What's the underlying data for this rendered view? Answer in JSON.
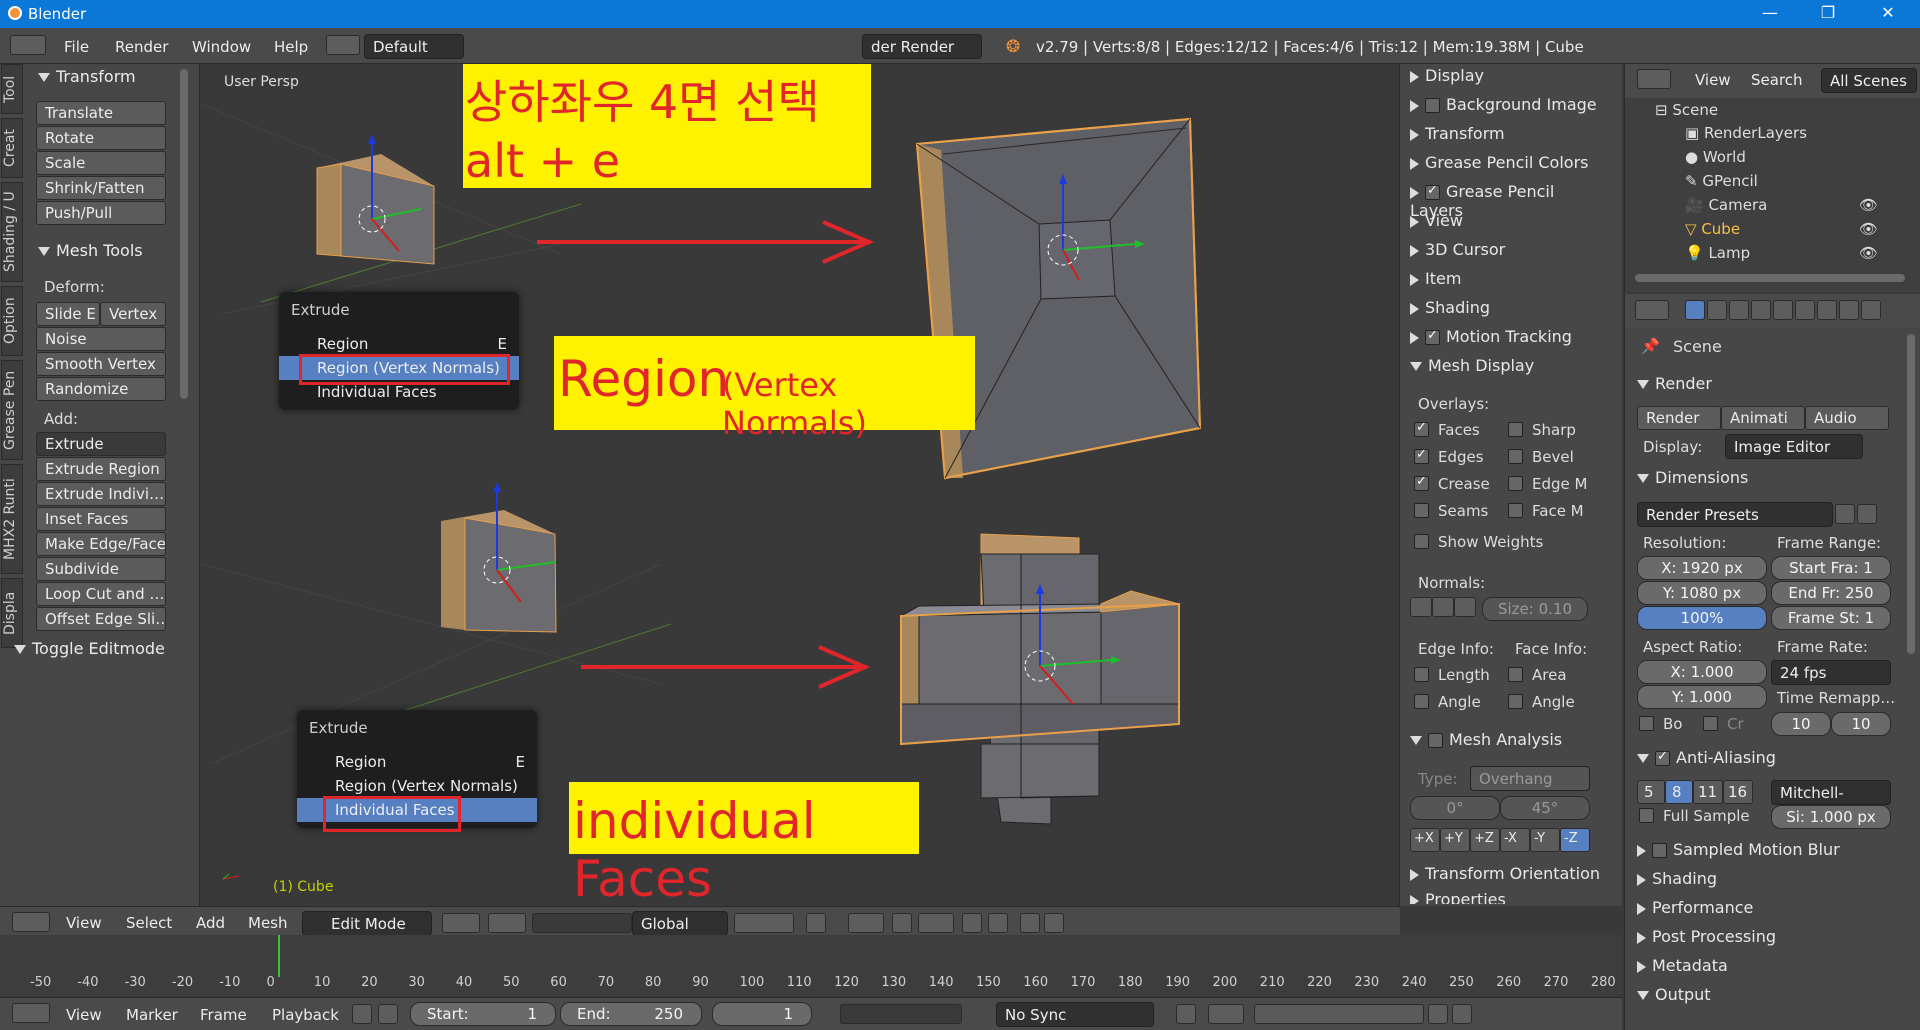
{
  "window": {
    "title": "Blender",
    "controls": [
      "—",
      "❐",
      "✕"
    ]
  },
  "infobar": {
    "menus": [
      "File",
      "Render",
      "Window",
      "Help"
    ],
    "layout": "Default",
    "engine": "der Render",
    "stats": "v2.79 | Verts:8/8 | Edges:12/12 | Faces:4/6 | Tris:12 | Mem:19.38M | Cube"
  },
  "toolshelf": {
    "tabs": [
      "Tool",
      "Creat",
      "Shading / U",
      "Option",
      "Grease Pen",
      "MHX2 Runti",
      "Displa"
    ],
    "transform_header": "Transform",
    "transform": [
      "Translate",
      "Rotate",
      "Scale",
      "Shrink/Fatten",
      "Push/Pull"
    ],
    "meshtools_header": "Mesh Tools",
    "deform_label": "Deform:",
    "slide_e": "Slide E",
    "vertex": "Vertex",
    "deform": [
      "Noise",
      "Smooth Vertex",
      "Randomize"
    ],
    "add_label": "Add:",
    "extrude_dd": "Extrude",
    "add": [
      "Extrude Region",
      "Extrude Indivi…",
      "Inset Faces",
      "Make Edge/Face",
      "Subdivide",
      "Loop Cut and …",
      "Offset Edge Sli…"
    ],
    "toggle": "Toggle Editmode"
  },
  "viewport": {
    "label": "User Persp",
    "object": "(1) Cube",
    "annotation_title": "상하좌우 4면 선택",
    "annotation_keys": "alt + e",
    "annotation_region_big": "Region",
    "annotation_region_small": "(Vertex Normals)",
    "annotation_individual": "individual Faces"
  },
  "popup_top": {
    "title": "Extrude",
    "items": [
      {
        "label": "Region",
        "key": "E"
      },
      {
        "label": "Region (Vertex Normals)",
        "key": ""
      },
      {
        "label": "Individual Faces",
        "key": ""
      }
    ],
    "selected": 1
  },
  "popup_bottom": {
    "title": "Extrude",
    "items": [
      {
        "label": "Region",
        "key": "E"
      },
      {
        "label": "Region (Vertex Normals)",
        "key": ""
      },
      {
        "label": "Individual Faces",
        "key": ""
      }
    ],
    "selected": 2
  },
  "properties_panel": {
    "rows": [
      "Display",
      "Background Image",
      "Transform",
      "Grease Pencil Colors",
      "Grease Pencil Layers",
      "View",
      "3D Cursor",
      "Item",
      "Shading",
      "Motion Tracking",
      "Mesh Display"
    ],
    "overlays_label": "Overlays:",
    "overlays_left": [
      {
        "label": "Faces",
        "on": true
      },
      {
        "label": "Edges",
        "on": true
      },
      {
        "label": "Crease",
        "on": true
      },
      {
        "label": "Seams",
        "on": false
      }
    ],
    "overlays_right": [
      {
        "label": "Sharp",
        "on": false
      },
      {
        "label": "Bevel",
        "on": false
      },
      {
        "label": "Edge M",
        "on": false
      },
      {
        "label": "Face M",
        "on": false
      }
    ],
    "show_weights": "Show Weights",
    "normals_label": "Normals:",
    "normals_size": "Size: 0.10",
    "edge_info": "Edge Info:",
    "face_info": "Face Info:",
    "edge_items": [
      "Length",
      "Angle"
    ],
    "face_items": [
      "Area",
      "Angle"
    ],
    "mesh_analysis": "Mesh Analysis",
    "type_label": "Type:",
    "type_value": "Overhang",
    "angle_min": "0°",
    "angle_max": "45°",
    "axes": [
      "+X",
      "+Y",
      "+Z",
      "-X",
      "-Y",
      "-Z"
    ],
    "transform_orientation": "Transform Orientation",
    "properties": "Properties"
  },
  "outliner": {
    "view": "View",
    "search": "Search",
    "scenes": "All Scenes",
    "items": [
      "Scene",
      "RenderLayers",
      "World",
      "GPencil",
      "Camera",
      "Cube",
      "Lamp"
    ]
  },
  "render_props": {
    "scene": "Scene",
    "render_header": "Render",
    "buttons": [
      "Render",
      "Animati",
      "Audio"
    ],
    "display_label": "Display:",
    "display_value": "Image Editor",
    "dimensions": "Dimensions",
    "presets": "Render Presets",
    "resolution_label": "Resolution:",
    "frame_range_label": "Frame Range:",
    "res_x": "X:  1920 px",
    "res_y": "Y:  1080 px",
    "res_pct": "100%",
    "start": "Start Fra: 1",
    "end": "End Fr: 250",
    "step": "Frame St: 1",
    "aspect_label": "Aspect Ratio:",
    "framerate_label": "Frame Rate:",
    "asp_x": "X:     1.000",
    "asp_y": "Y:     1.000",
    "fps": "24 fps",
    "remap": "Time Remapp…",
    "bo": "Bo",
    "cr": "Cr",
    "remap_old": "10",
    "remap_new": "10",
    "aa": "Anti-Aliasing",
    "aa_samples": [
      "5",
      "8",
      "11",
      "16"
    ],
    "aa_filter": "Mitchell-Net…",
    "full_sample": "Full Sample",
    "filter_size": "Si: 1.000 px",
    "sections": [
      "Sampled Motion Blur",
      "Shading",
      "Performance",
      "Post Processing",
      "Metadata",
      "Output"
    ]
  },
  "vp_header": {
    "menus": [
      "View",
      "Select",
      "Add",
      "Mesh"
    ],
    "mode": "Edit Mode",
    "orientation": "Global"
  },
  "timeline": {
    "ticks": [
      "-50",
      "-40",
      "-30",
      "-20",
      "-10",
      "0",
      "10",
      "20",
      "30",
      "40",
      "50",
      "60",
      "70",
      "80",
      "90",
      "100",
      "110",
      "120",
      "130",
      "140",
      "150",
      "160",
      "170",
      "180",
      "190",
      "200",
      "210",
      "220",
      "230",
      "240",
      "250",
      "260",
      "270",
      "280"
    ],
    "menus": [
      "View",
      "Marker",
      "Frame",
      "Playback"
    ],
    "start_label": "Start:",
    "start": "1",
    "end_label": "End:",
    "end": "250",
    "current": "1",
    "sync": "No Sync"
  }
}
